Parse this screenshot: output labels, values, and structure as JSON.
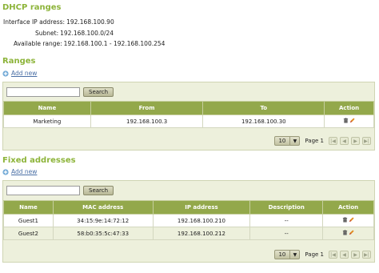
{
  "dhcp": {
    "title": "DHCP ranges",
    "interface_ip_label": "Interface IP address:",
    "interface_ip_value": "192.168.100.90",
    "subnet_label": "Subnet:",
    "subnet_value": "192.168.100.0/24",
    "available_label": "Available range:",
    "available_value": "192.168.100.1 - 192.168.100.254"
  },
  "ranges": {
    "title": "Ranges",
    "add_label": "Add new",
    "search_placeholder": "",
    "search_button": "Search",
    "columns": [
      "Name",
      "From",
      "To",
      "Action"
    ],
    "rows": [
      {
        "name": "Marketing",
        "from": "192.168.100.3",
        "to": "192.168.100.30"
      }
    ],
    "page_size": "10",
    "page_label": "Page 1"
  },
  "fixed": {
    "title": "Fixed addresses",
    "add_label": "Add new",
    "search_placeholder": "",
    "search_button": "Search",
    "columns": [
      "Name",
      "MAC address",
      "IP address",
      "Description",
      "Action"
    ],
    "rows": [
      {
        "name": "Guest1",
        "mac": "34:15:9e:14:72:12",
        "ip": "192.168.100.210",
        "description": "--"
      },
      {
        "name": "Guest2",
        "mac": "58:b0:35:5c:47:33",
        "ip": "192.168.100.212",
        "description": "--"
      }
    ],
    "page_size": "10",
    "page_label": "Page 1"
  },
  "colors": {
    "accent": "#8db43a",
    "header_bg": "#93a84b",
    "panel_bg": "#edf0dc"
  },
  "icons": {
    "add": "plus-icon",
    "delete": "trash-icon",
    "edit": "pencil-icon"
  }
}
